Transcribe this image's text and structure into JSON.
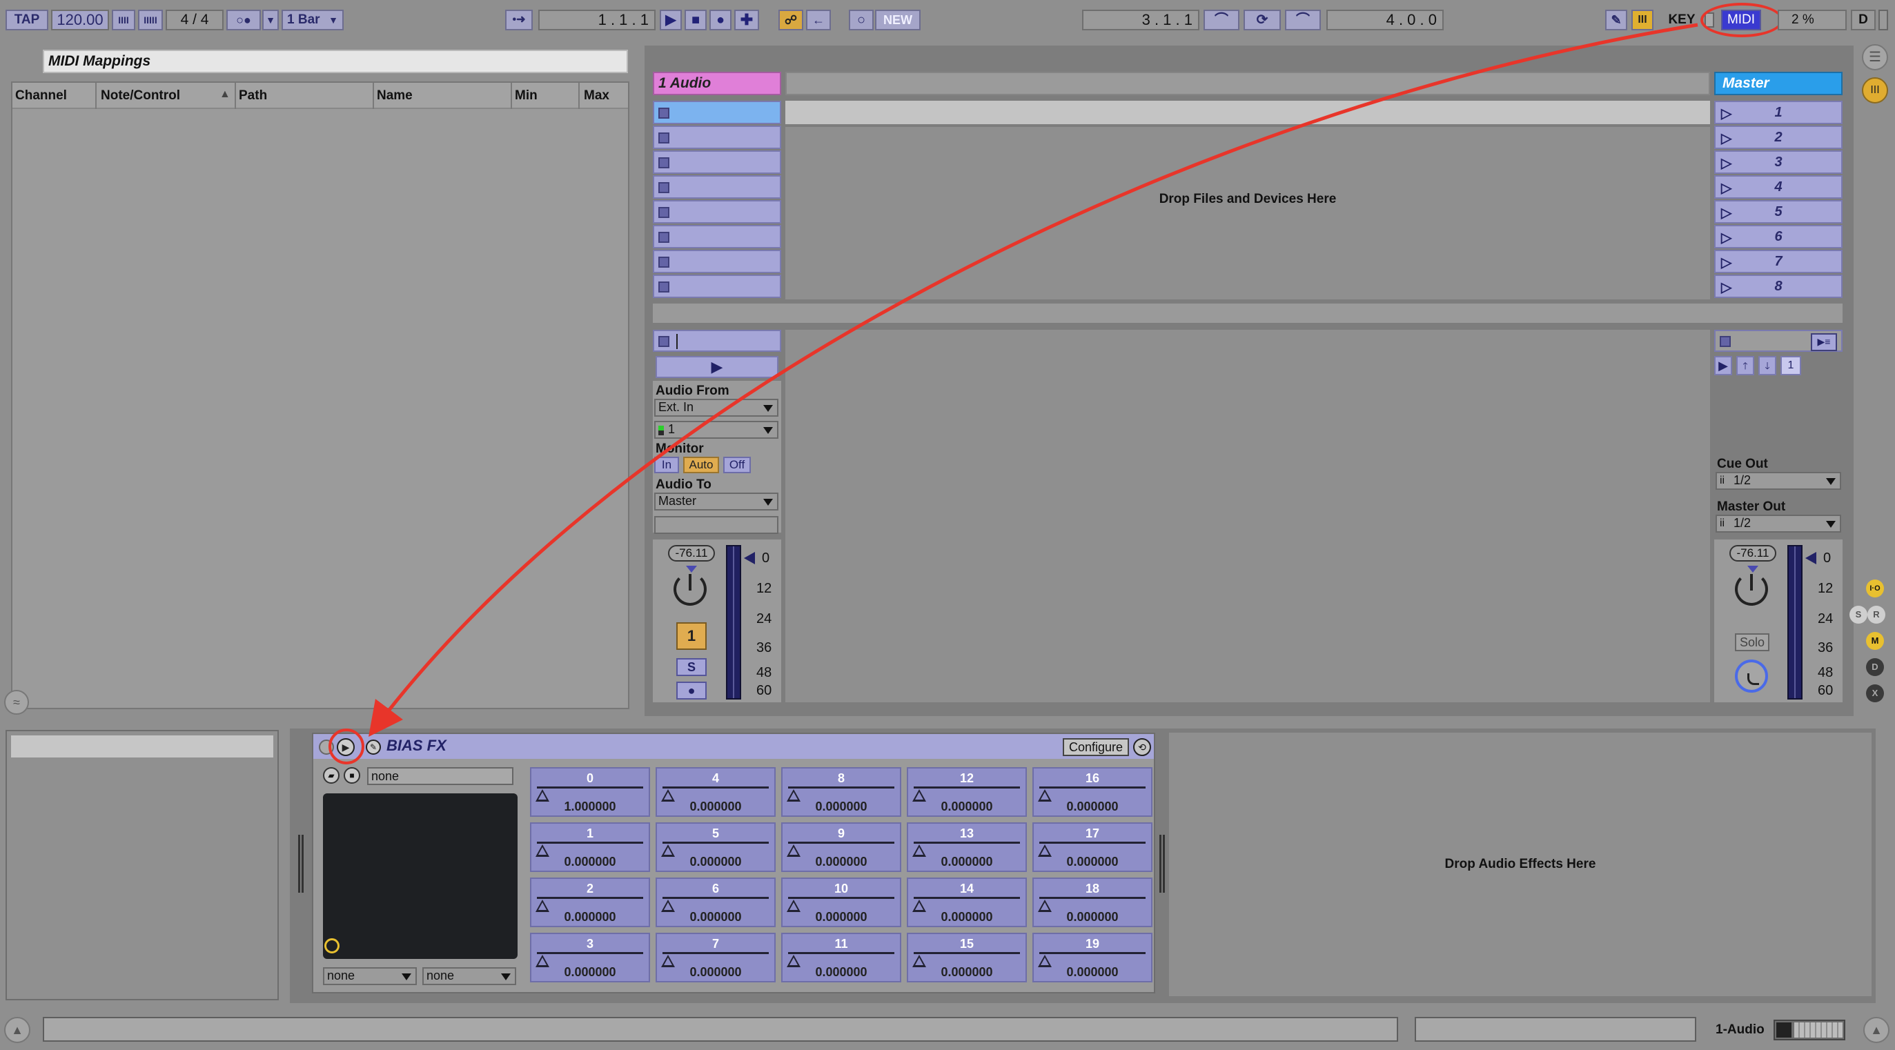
{
  "transport": {
    "tap": "TAP",
    "tempo": "120.00",
    "signature": "4 / 4",
    "quantize": "1 Bar",
    "position": "1 .  1 .  1",
    "new": "NEW",
    "loop_start": "3 .  1 .  1",
    "loop_length": "4 .  0 .  0",
    "key": "KEY",
    "midi": "MIDI",
    "cpu": "2 %",
    "d": "D"
  },
  "browser": {
    "title": "MIDI Mappings",
    "columns": [
      "Channel",
      "Note/Control",
      "Path",
      "Name",
      "Min",
      "Max"
    ]
  },
  "session": {
    "track_name": "1 Audio",
    "master_name": "Master",
    "drop_hint": "Drop Files and Devices Here",
    "scenes": [
      "1",
      "2",
      "3",
      "4",
      "5",
      "6",
      "7",
      "8"
    ]
  },
  "io": {
    "audio_from_label": "Audio From",
    "audio_from_value": "Ext. In",
    "channel_value": "1",
    "monitor_label": "Monitor",
    "monitor_options": [
      "In",
      "Auto",
      "Off"
    ],
    "audio_to_label": "Audio To",
    "audio_to_value": "Master",
    "cue_out_label": "Cue Out",
    "cue_out_value": "1/2",
    "master_out_label": "Master Out",
    "master_out_value": "1/2"
  },
  "mixer": {
    "track_volume": "-76.11",
    "master_volume": "-76.11",
    "track_number": "1",
    "solo_short": "S",
    "solo": "Solo",
    "meter_ticks": [
      "0",
      "12",
      "24",
      "36",
      "48",
      "60"
    ],
    "scene_count_box": "1"
  },
  "side_labels": {
    "io": "I·O",
    "s": "S",
    "r": "R",
    "m": "M",
    "d": "D",
    "x": "X"
  },
  "device": {
    "name": "BIAS FX",
    "configure": "Configure",
    "preset": "none",
    "xy_x": "none",
    "xy_y": "none",
    "drop_effects": "Drop Audio Effects Here",
    "macros": [
      {
        "num": "0",
        "val": "1.000000"
      },
      {
        "num": "4",
        "val": "0.000000"
      },
      {
        "num": "8",
        "val": "0.000000"
      },
      {
        "num": "12",
        "val": "0.000000"
      },
      {
        "num": "16",
        "val": "0.000000"
      },
      {
        "num": "1",
        "val": "0.000000"
      },
      {
        "num": "5",
        "val": "0.000000"
      },
      {
        "num": "9",
        "val": "0.000000"
      },
      {
        "num": "13",
        "val": "0.000000"
      },
      {
        "num": "17",
        "val": "0.000000"
      },
      {
        "num": "2",
        "val": "0.000000"
      },
      {
        "num": "6",
        "val": "0.000000"
      },
      {
        "num": "10",
        "val": "0.000000"
      },
      {
        "num": "14",
        "val": "0.000000"
      },
      {
        "num": "18",
        "val": "0.000000"
      },
      {
        "num": "3",
        "val": "0.000000"
      },
      {
        "num": "7",
        "val": "0.000000"
      },
      {
        "num": "11",
        "val": "0.000000"
      },
      {
        "num": "15",
        "val": "0.000000"
      },
      {
        "num": "19",
        "val": "0.000000"
      }
    ]
  },
  "status": {
    "track": "1-Audio"
  }
}
